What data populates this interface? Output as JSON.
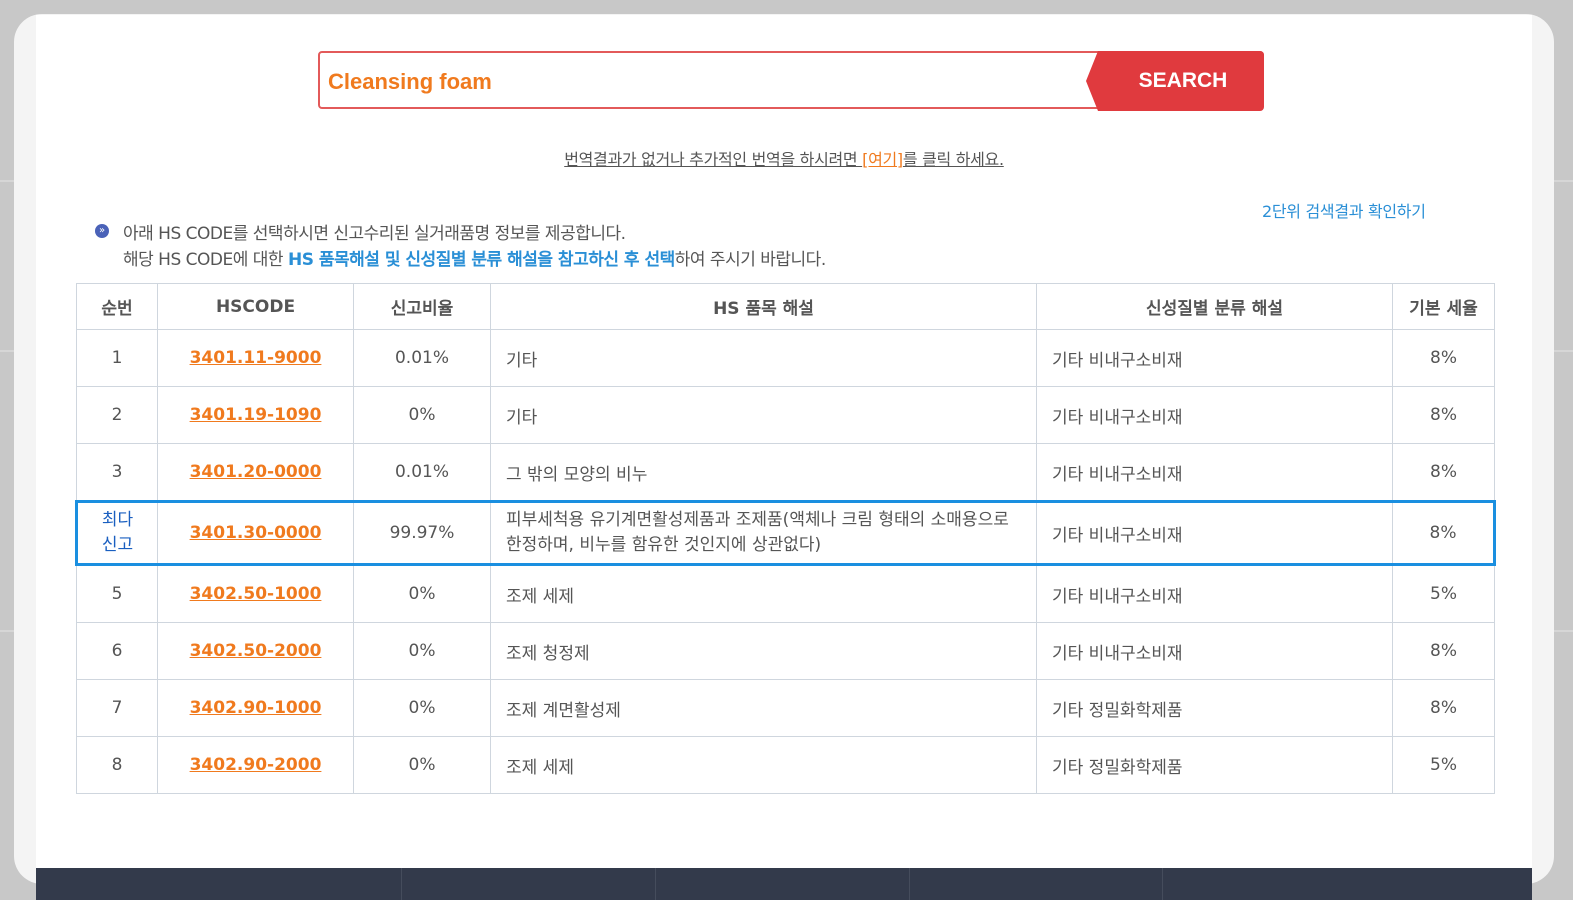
{
  "search": {
    "value": "Cleansing foam",
    "button_label": "SEARCH"
  },
  "translate_notice": {
    "before": "번역결과가 없거나 추가적인 번역을 하시려면 ",
    "link": "[여기]",
    "after": "를 클릭 하세요."
  },
  "level2_link": "2단위 검색결과 확인하기",
  "info": {
    "line1": "아래 HS CODE를 선택하시면 신고수리된 실거래품명 정보를 제공합니다.",
    "line2_prefix": "해당 HS CODE에 대한 ",
    "line2_highlight": "HS 품목해설 및 신성질별 분류 해설을 참고하신 후 선택",
    "line2_suffix": "하여 주시기 바랍니다."
  },
  "table": {
    "headers": [
      "순번",
      "HSCODE",
      "신고비율",
      "HS 품목 해설",
      "신성질별 분류 해설",
      "기본 세율"
    ],
    "rows": [
      {
        "no": "1",
        "code": "3401.11-9000",
        "ratio": "0.01%",
        "desc": "기타",
        "class": "기타 비내구소비재",
        "rate": "8%"
      },
      {
        "no": "2",
        "code": "3401.19-1090",
        "ratio": "0%",
        "desc": "기타",
        "class": "기타 비내구소비재",
        "rate": "8%"
      },
      {
        "no": "3",
        "code": "3401.20-0000",
        "ratio": "0.01%",
        "desc": "그 밖의 모양의 비누",
        "class": "기타 비내구소비재",
        "rate": "8%"
      },
      {
        "no_line1": "최다",
        "no_line2": "신고",
        "code": "3401.30-0000",
        "ratio": "99.97%",
        "desc_line1": "피부세척용 유기계면활성제품과 조제품(액체나 크림 형태의 소매용으로",
        "desc_line2": "한정하며, 비누를 함유한 것인지에 상관없다)",
        "class": "기타 비내구소비재",
        "rate": "8%"
      },
      {
        "no": "5",
        "code": "3402.50-1000",
        "ratio": "0%",
        "desc": "조제 세제",
        "class": "기타 비내구소비재",
        "rate": "5%"
      },
      {
        "no": "6",
        "code": "3402.50-2000",
        "ratio": "0%",
        "desc": "조제 청정제",
        "class": "기타 비내구소비재",
        "rate": "8%"
      },
      {
        "no": "7",
        "code": "3402.90-1000",
        "ratio": "0%",
        "desc": "조제 계면활성제",
        "class": "기타 정밀화학제품",
        "rate": "8%"
      },
      {
        "no": "8",
        "code": "3402.90-2000",
        "ratio": "0%",
        "desc": "조제 세제",
        "class": "기타 정밀화학제품",
        "rate": "5%"
      }
    ]
  },
  "colors": {
    "accent_orange": "#f07a1e",
    "search_red": "#e03a3e",
    "link_blue": "#2a8fd6",
    "highlight_border": "#1a8fe0",
    "footer": "#333a4b"
  }
}
